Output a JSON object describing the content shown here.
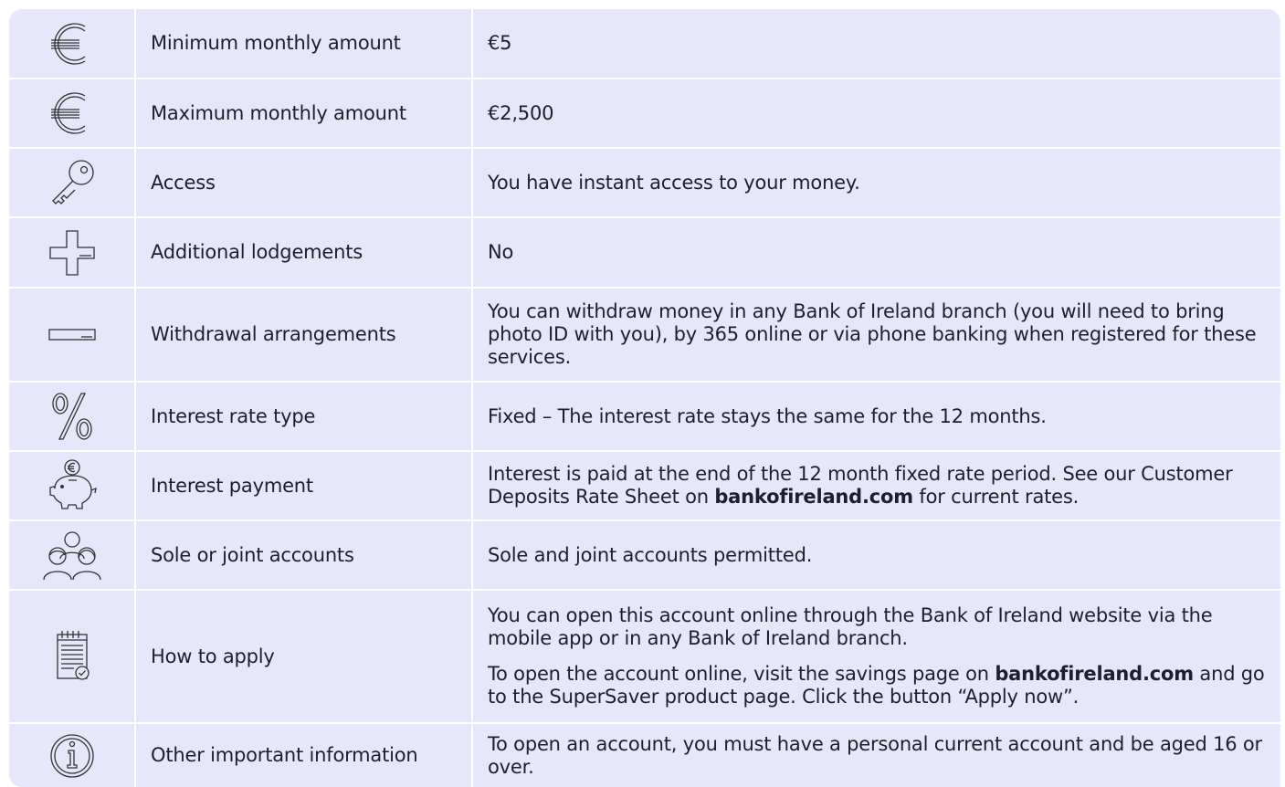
{
  "rows": [
    {
      "icon": "euro-icon",
      "label": "Minimum monthly amount",
      "value": "€5"
    },
    {
      "icon": "euro-icon",
      "label": "Maximum monthly amount",
      "value": "€2,500"
    },
    {
      "icon": "key-icon",
      "label": "Access",
      "value": "You have instant access to your money."
    },
    {
      "icon": "plus-icon",
      "label": "Additional lodgements",
      "value": "No"
    },
    {
      "icon": "minus-icon",
      "label": "Withdrawal arrangements",
      "value": "You can withdraw money in any Bank of Ireland branch (you will need to bring photo ID with you), by 365 online or via phone banking when registered for these services."
    },
    {
      "icon": "percent-icon",
      "label": "Interest rate type",
      "value": "Fixed – The interest rate stays the same for the 12 months."
    },
    {
      "icon": "piggy-bank-icon",
      "label": "Interest payment",
      "value_pre": "Interest is paid at the end of the 12 month fixed rate period. See our Customer Deposits Rate Sheet on ",
      "value_bold": "bankofireland.com",
      "value_post": " for current rates."
    },
    {
      "icon": "people-icon",
      "label": "Sole or joint accounts",
      "value": "Sole and joint accounts permitted."
    },
    {
      "icon": "checklist-icon",
      "label": "How to apply",
      "value": "You can open this account online through the Bank of Ireland website via the mobile app or in any Bank of Ireland branch.",
      "value2_pre": "To open the account online, visit the savings page on ",
      "value2_bold": "bankofireland.com",
      "value2_post": " and go to the SuperSaver product page. Click the button “Apply now”."
    },
    {
      "icon": "info-icon",
      "label": "Other important information",
      "value": "To open an account, you must have a personal current account and be aged 16 or over."
    }
  ]
}
